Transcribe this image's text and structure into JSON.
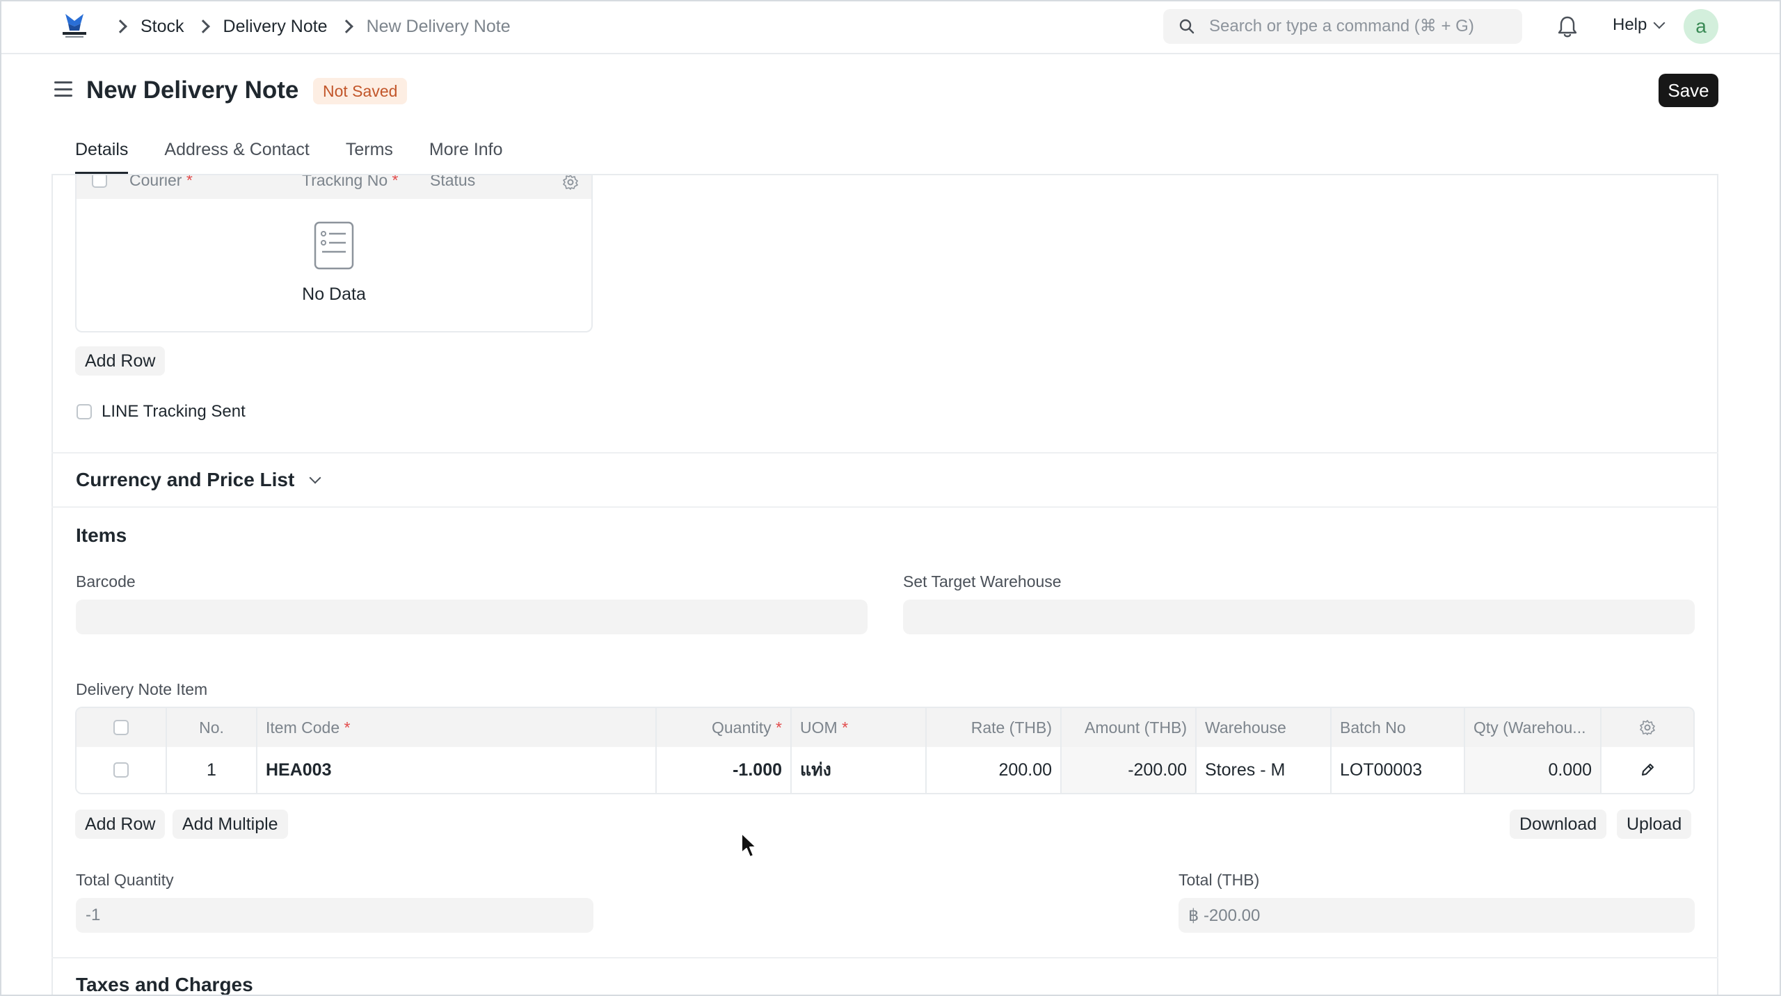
{
  "navbar": {
    "breadcrumbs": [
      "Stock",
      "Delivery Note",
      "New Delivery Note"
    ],
    "search_placeholder": "Search or type a command (⌘ + G)",
    "help_label": "Help",
    "avatar_initial": "a"
  },
  "header": {
    "title": "New Delivery Note",
    "status_badge": "Not Saved",
    "save_label": "Save"
  },
  "tabs": [
    {
      "label": "Details",
      "active": true
    },
    {
      "label": "Address & Contact",
      "active": false
    },
    {
      "label": "Terms",
      "active": false
    },
    {
      "label": "More Info",
      "active": false
    }
  ],
  "tracking_table": {
    "columns": [
      "Courier",
      "Tracking No",
      "Status"
    ],
    "empty_text": "No Data",
    "add_row_label": "Add Row"
  },
  "line_tracking_label": "LINE Tracking Sent",
  "currency_section_title": "Currency and Price List",
  "items_section": {
    "title": "Items",
    "barcode_label": "Barcode",
    "barcode_value": "",
    "target_warehouse_label": "Set Target Warehouse",
    "target_warehouse_value": "",
    "table_label": "Delivery Note Item",
    "columns": {
      "no": "No.",
      "item_code": "Item Code",
      "quantity": "Quantity",
      "uom": "UOM",
      "rate": "Rate (THB)",
      "amount": "Amount (THB)",
      "warehouse": "Warehouse",
      "batch_no": "Batch No",
      "qty_warehouse": "Qty (Warehou..."
    },
    "rows": [
      {
        "no": "1",
        "item_code": "HEA003",
        "quantity": "-1.000",
        "uom": "แท่ง",
        "rate": "200.00",
        "amount": "-200.00",
        "warehouse": "Stores - M",
        "batch_no": "LOT00003",
        "qty_warehouse": "0.000"
      }
    ],
    "add_row_label": "Add Row",
    "add_multiple_label": "Add Multiple",
    "download_label": "Download",
    "upload_label": "Upload",
    "total_quantity_label": "Total Quantity",
    "total_quantity_value": "-1",
    "total_label": "Total (THB)",
    "total_value": "฿ -200.00"
  },
  "taxes_section_title": "Taxes and Charges",
  "colors": {
    "badge_bg": "#fdeee3",
    "badge_text": "#c2562a",
    "required": "#e24c4c",
    "primary_button": "#171717"
  }
}
